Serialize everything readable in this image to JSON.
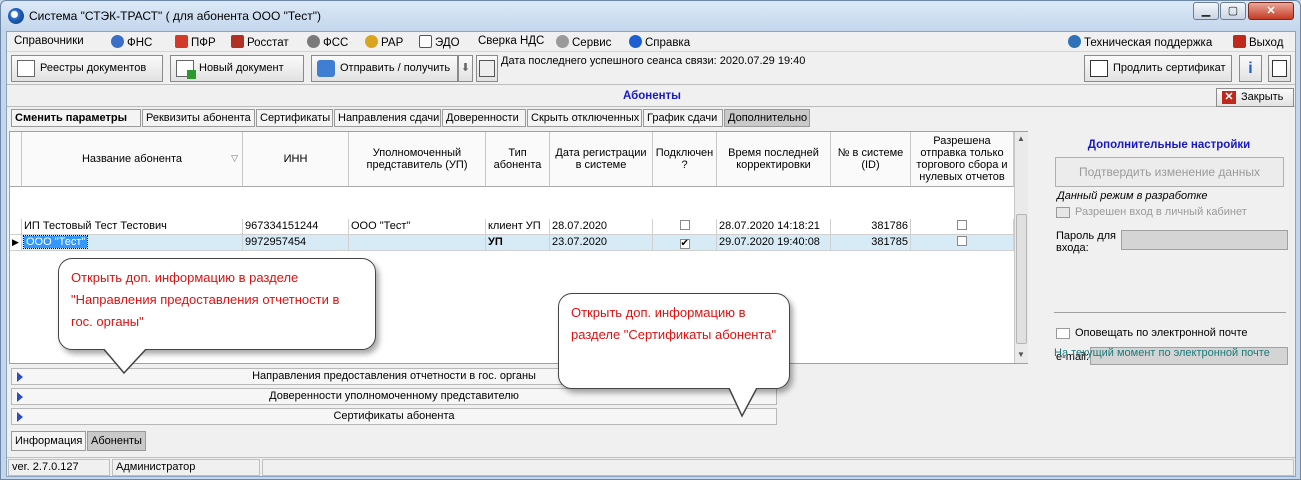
{
  "window": {
    "title": "Система \"СТЭК-ТРАСТ\" ( для абонента ООО \"Тест\")",
    "btn_min": "▁",
    "btn_max": "▢",
    "btn_close": "✕"
  },
  "menu": [
    {
      "label": "Справочники",
      "icon": ""
    },
    {
      "label": "ФНС",
      "icon": "fns-icon"
    },
    {
      "label": "ПФР",
      "icon": "pfr-icon"
    },
    {
      "label": "Росстат",
      "icon": "rosstat-icon"
    },
    {
      "label": "ФСС",
      "icon": "fss-icon"
    },
    {
      "label": "РАР",
      "icon": "rar-icon"
    },
    {
      "label": "ЭДО",
      "icon": "edo-icon"
    },
    {
      "label": "Сверка НДС",
      "icon": ""
    },
    {
      "label": "Сервис",
      "icon": "gear-icon"
    },
    {
      "label": "Справка",
      "icon": "help-icon"
    }
  ],
  "menu_right": {
    "support": "Техническая поддержка",
    "exit": "Выход"
  },
  "toolbar": {
    "registries": "Реестры документов",
    "new_doc": "Новый документ",
    "send_receive": "Отправить / получить",
    "session": "Дата последнего успешного сеанса связи: 2020.07.29 19:40",
    "extend_cert": "Продлить сертификат"
  },
  "section": {
    "title": "Абоненты",
    "close": "Закрыть"
  },
  "tabs": [
    "Сменить параметры",
    "Реквизиты абонента",
    "Сертификаты",
    "Направления сдачи",
    "Доверенности",
    "Скрыть отключенных",
    "График сдачи",
    "Дополнительно"
  ],
  "grid": {
    "columns": [
      "Название абонента",
      "ИНН",
      "Уполномоченный представитель (УП)",
      "Тип абонента",
      "Дата регистрации в системе",
      "Подключен ?",
      "Время последней корректировки",
      "№ в системе (ID)",
      "Разрешена отправка только торгового сбора и нулевых отчетов"
    ],
    "sort_indicator": "▽",
    "rows": [
      {
        "name": "ИП Тестовый Тест Тестович",
        "inn": "967334151244",
        "rep": "ООО \"Тест\"",
        "type": "клиент УП",
        "date": "28.07.2020",
        "connected": "",
        "modified": "28.07.2020 14:18:21",
        "id": "381786",
        "zero": ""
      },
      {
        "name": "ООО \"Тест\"",
        "inn": "9972957454",
        "rep": "",
        "type": "УП",
        "date": "23.07.2020",
        "connected": "✔",
        "modified": "29.07.2020 19:40:08",
        "id": "381785",
        "zero": ""
      }
    ]
  },
  "right_panel": {
    "title": "Дополнительные настройки",
    "confirm_btn": "Подтвердить изменение данных",
    "dev_note": "Данный режим в разработке",
    "cabinet": "Разрешен вход в личный кабинет",
    "password_label": "Пароль для входа:",
    "notify": "Оповещать по электронной почте",
    "email_label": "e-mail:",
    "current": "На текущий момент по электронной почте"
  },
  "expanders": [
    "Направления предоставления отчетности в гос. органы",
    "Доверенности уполномоченному представителю",
    "Сертификаты абонента"
  ],
  "callouts": [
    "Открыть доп. информацию в разделе \"Направления предоставления отчетности в гос. органы\"",
    "Открыть доп. информацию в разделе \"Сертификаты абонента\""
  ],
  "bottom_tabs": [
    "Информация",
    "Абоненты"
  ],
  "status": {
    "version": "ver. 2.7.0.127",
    "user": "Администратор"
  }
}
